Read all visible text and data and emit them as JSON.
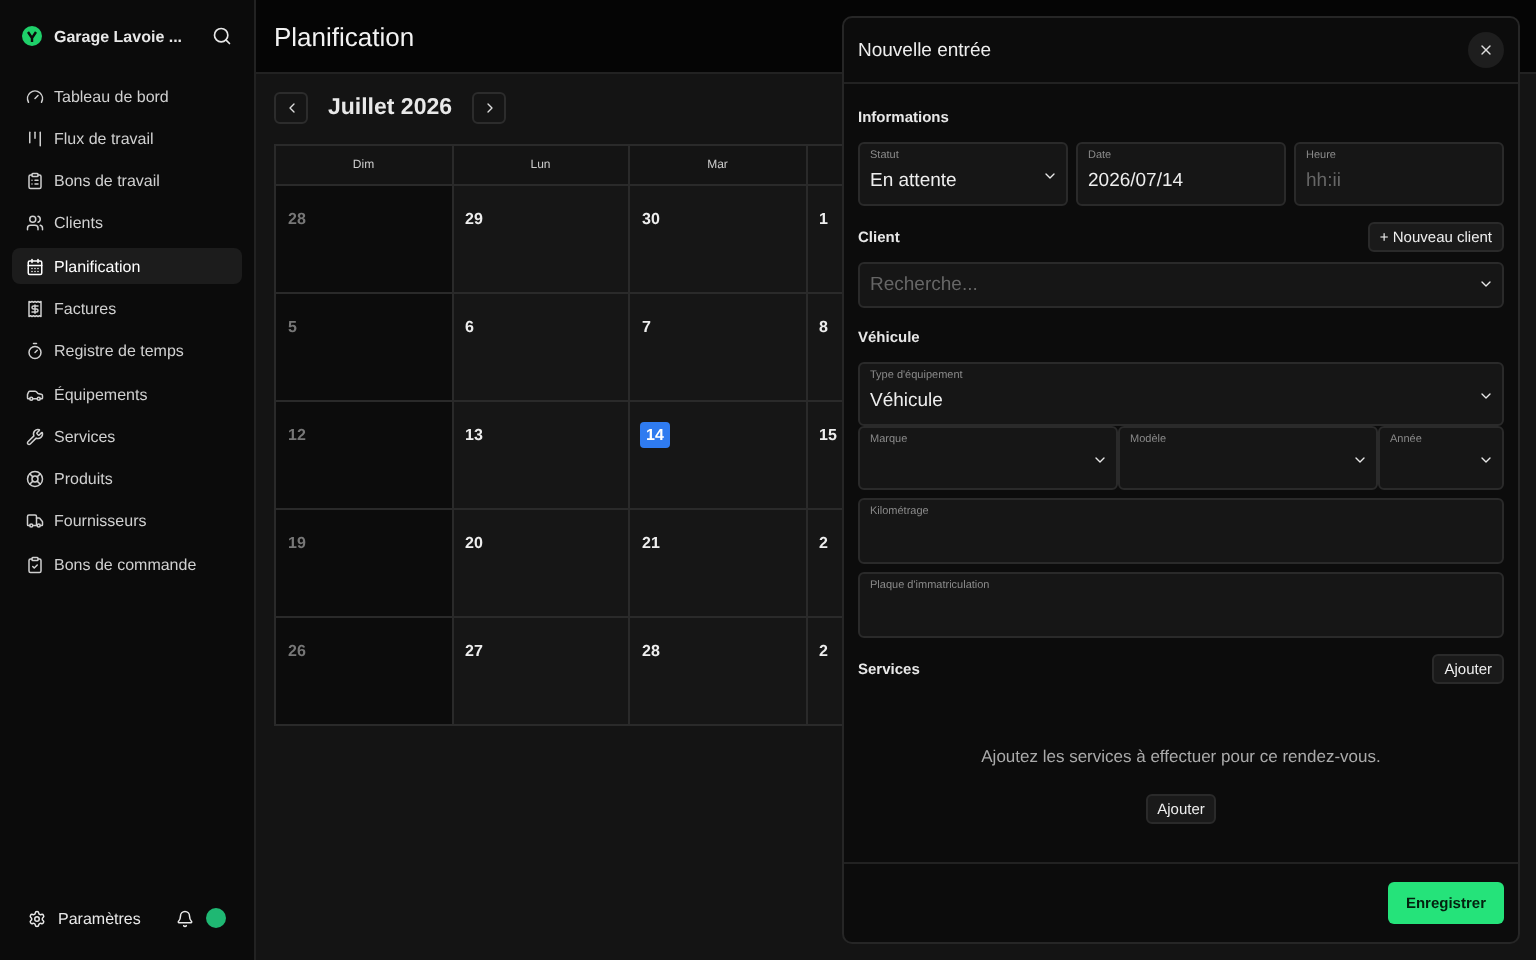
{
  "sidebar": {
    "brand": "Garage Lavoie ...",
    "items": [
      {
        "label": "Tableau de bord",
        "selected": false
      },
      {
        "label": "Flux de travail",
        "selected": false
      },
      {
        "label": "Bons de travail",
        "selected": false
      },
      {
        "label": "Clients",
        "selected": false
      },
      {
        "label": "Planification",
        "selected": true
      },
      {
        "label": "Factures",
        "selected": false
      },
      {
        "label": "Registre de temps",
        "selected": false
      },
      {
        "label": "Équipements",
        "selected": false
      },
      {
        "label": "Services",
        "selected": false
      },
      {
        "label": "Produits",
        "selected": false
      },
      {
        "label": "Fournisseurs",
        "selected": false
      },
      {
        "label": "Bons de commande",
        "selected": false
      }
    ],
    "settings": "Paramètres"
  },
  "page": {
    "title": "Planification"
  },
  "calendar": {
    "month": "Juillet 2026",
    "weekdays": [
      "Dim",
      "Lun",
      "Mar"
    ],
    "weeks": [
      [
        {
          "day": "28",
          "weekend": true,
          "today": false
        },
        {
          "day": "29",
          "weekend": false,
          "today": false
        },
        {
          "day": "30",
          "weekend": false,
          "today": false
        },
        {
          "day": "1",
          "weekend": false,
          "today": false
        }
      ],
      [
        {
          "day": "5",
          "weekend": true,
          "today": false
        },
        {
          "day": "6",
          "weekend": false,
          "today": false
        },
        {
          "day": "7",
          "weekend": false,
          "today": false
        },
        {
          "day": "8",
          "weekend": false,
          "today": false
        }
      ],
      [
        {
          "day": "12",
          "weekend": true,
          "today": false
        },
        {
          "day": "13",
          "weekend": false,
          "today": false
        },
        {
          "day": "14",
          "weekend": false,
          "today": true
        },
        {
          "day": "15",
          "weekend": false,
          "today": false
        }
      ],
      [
        {
          "day": "19",
          "weekend": true,
          "today": false
        },
        {
          "day": "20",
          "weekend": false,
          "today": false
        },
        {
          "day": "21",
          "weekend": false,
          "today": false
        },
        {
          "day": "2",
          "weekend": false,
          "today": false
        }
      ],
      [
        {
          "day": "26",
          "weekend": true,
          "today": false
        },
        {
          "day": "27",
          "weekend": false,
          "today": false
        },
        {
          "day": "28",
          "weekend": false,
          "today": false
        },
        {
          "day": "2",
          "weekend": false,
          "today": false
        }
      ]
    ]
  },
  "drawer": {
    "title": "Nouvelle entrée",
    "informations": {
      "heading": "Informations",
      "fields": [
        {
          "kind": "select",
          "label": "Statut",
          "value": "En attente"
        },
        {
          "kind": "input",
          "label": "Date",
          "value": "2026/07/14"
        },
        {
          "kind": "input",
          "label": "Heure",
          "placeholder": "hh:ii"
        }
      ]
    },
    "client": {
      "heading": "Client",
      "new_button": "+ Nouveau client",
      "search": {
        "placeholder": "Recherche..."
      }
    },
    "vehicle": {
      "heading": "Véhicule",
      "type_field": {
        "label": "Type d'équipement",
        "value": "Véhicule"
      },
      "row": [
        {
          "label": "Marque"
        },
        {
          "label": "Modèle"
        },
        {
          "label": "Année"
        }
      ],
      "fields": [
        {
          "label": "Kilométrage"
        },
        {
          "label": "Plaque d'immatriculation"
        }
      ]
    },
    "services": {
      "heading": "Services",
      "add_button": "Ajouter",
      "empty_text": "Ajoutez les services à effectuer pour ce rendez-vous.",
      "empty_button": "Ajouter"
    },
    "save_button": "Enregistrer"
  }
}
